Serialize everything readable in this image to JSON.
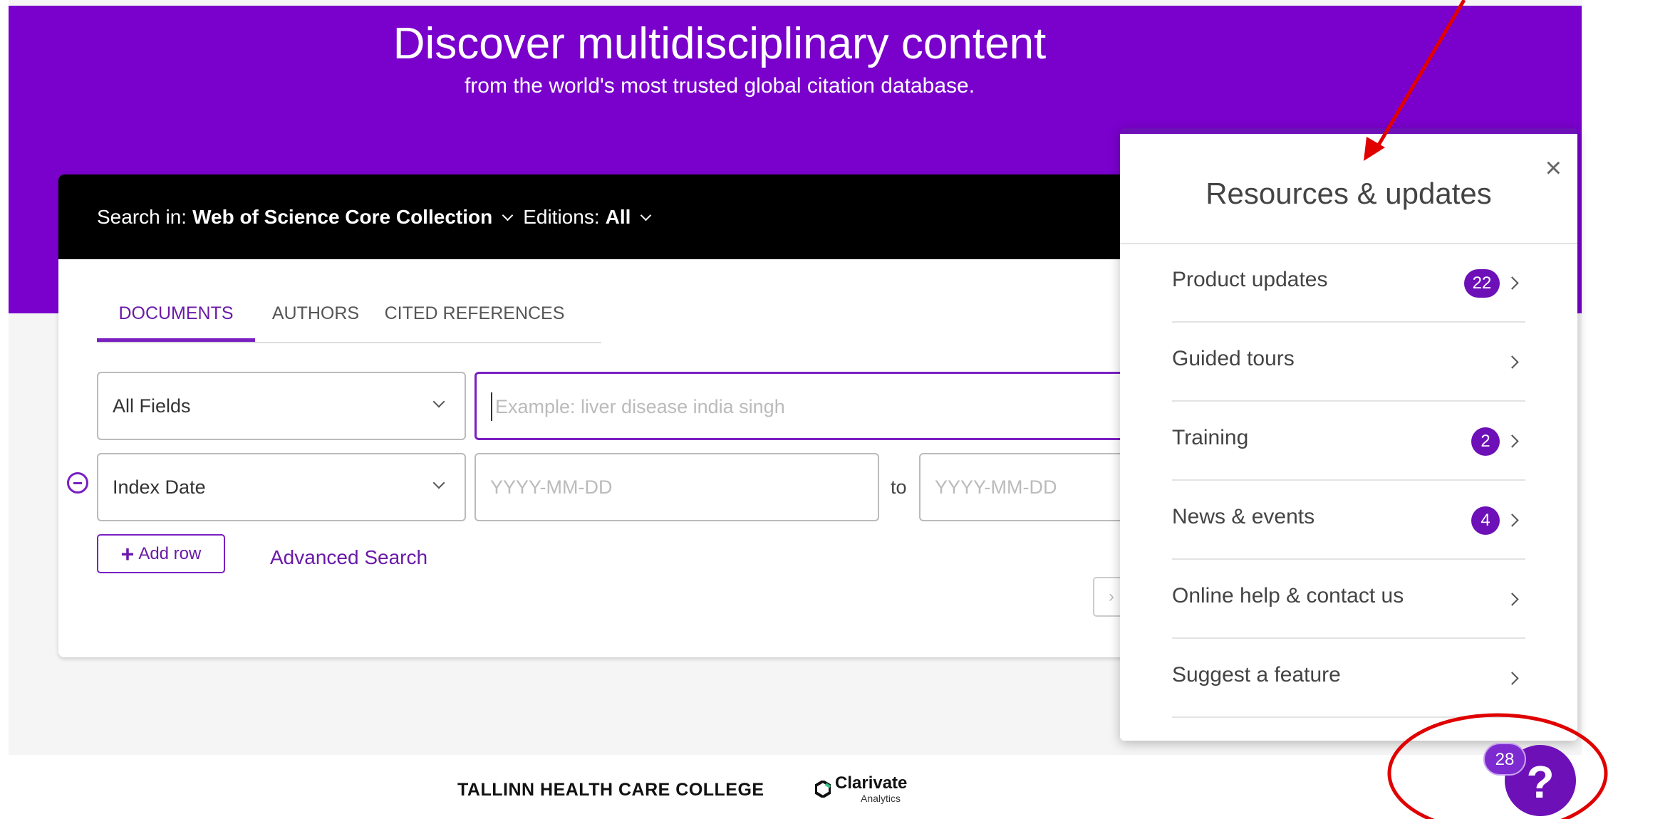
{
  "hero": {
    "title": "Discover multidisciplinary content",
    "subtitle": "from the world's most trusted global citation database."
  },
  "search_bar": {
    "search_in_label": "Search in:",
    "collection": "Web of Science Core Collection",
    "editions_label": "Editions:",
    "editions_value": "All"
  },
  "tabs": [
    "DOCUMENTS",
    "AUTHORS",
    "CITED REFERENCES"
  ],
  "active_tab": "DOCUMENTS",
  "rows": [
    {
      "field": "All Fields",
      "placeholder": "Example: liver disease india singh"
    },
    {
      "field": "Index Date",
      "from_placeholder": "YYYY-MM-DD",
      "to_label": "to",
      "to_placeholder": "YYYY-MM-DD"
    }
  ],
  "add_row_label": "Add row",
  "advanced_search_label": "Advanced Search",
  "panel": {
    "title": "Resources & updates",
    "close_glyph": "×",
    "items": [
      {
        "label": "Product updates",
        "badge": "22"
      },
      {
        "label": "Guided tours",
        "badge": ""
      },
      {
        "label": "Training",
        "badge": "2"
      },
      {
        "label": "News & events",
        "badge": "4"
      },
      {
        "label": "Online help & contact us",
        "badge": ""
      },
      {
        "label": "Suggest a feature",
        "badge": ""
      }
    ]
  },
  "footer": {
    "institution": "TALLINN HEALTH CARE COLLEGE",
    "logo_name": "Clarivate",
    "logo_sub": "Analytics"
  },
  "help": {
    "glyph": "?",
    "badge": "28"
  },
  "colors": {
    "brand_purple": "#7a00cc",
    "accent_purple": "#6d10b8",
    "annotation_red": "#e00000"
  }
}
